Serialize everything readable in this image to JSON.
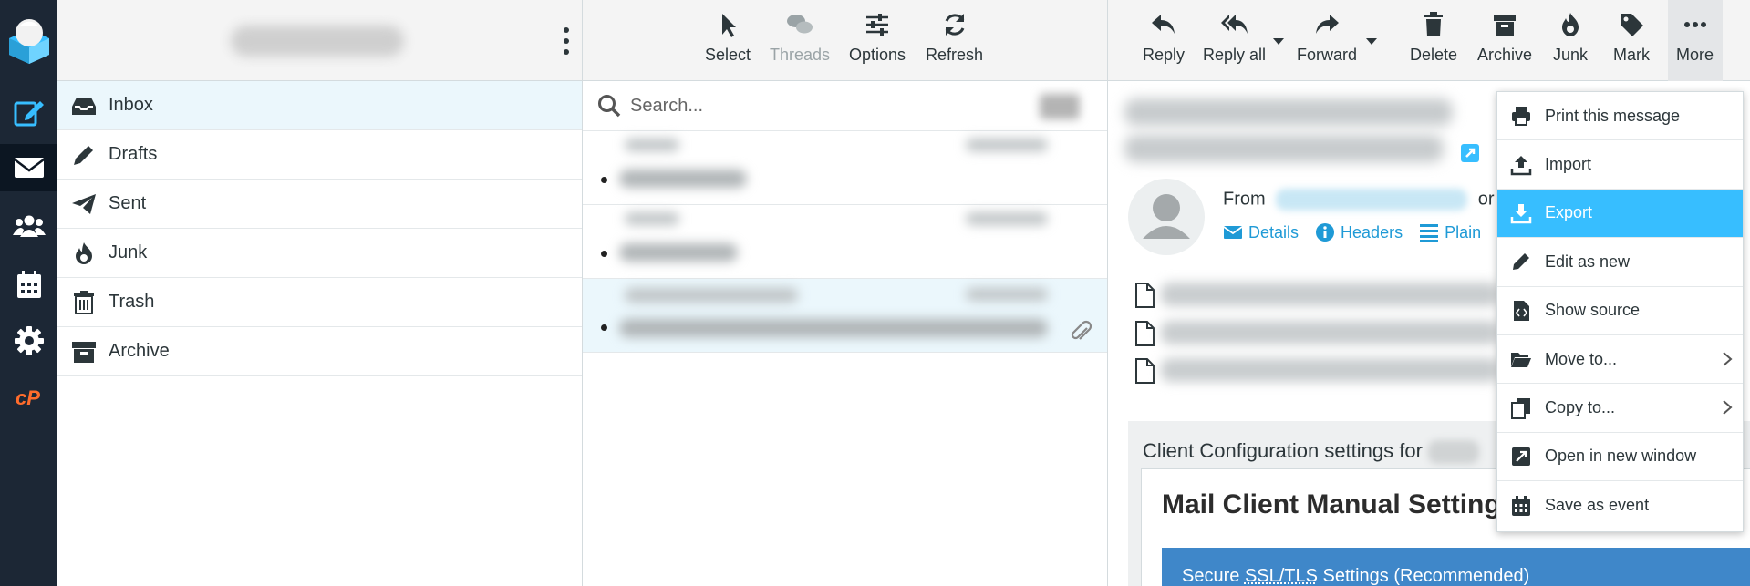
{
  "colors": {
    "accent": "#37beff",
    "link": "#1f9ad6",
    "sidebar_bg": "#1c2735",
    "cpanel_orange": "#ff6c2c"
  },
  "taskbar": {
    "items": [
      {
        "name": "compose",
        "icon": "compose-icon"
      },
      {
        "name": "mail",
        "icon": "envelope-icon"
      },
      {
        "name": "contacts",
        "icon": "users-icon"
      },
      {
        "name": "calendar",
        "icon": "calendar-icon"
      },
      {
        "name": "settings",
        "icon": "gear-icon"
      },
      {
        "name": "cpanel",
        "icon": "cpanel-icon"
      }
    ]
  },
  "folders": [
    {
      "label": "Inbox",
      "icon": "inbox-icon"
    },
    {
      "label": "Drafts",
      "icon": "pencil-icon"
    },
    {
      "label": "Sent",
      "icon": "paper-plane-icon"
    },
    {
      "label": "Junk",
      "icon": "fire-icon"
    },
    {
      "label": "Trash",
      "icon": "trash-icon"
    },
    {
      "label": "Archive",
      "icon": "archive-box-icon"
    }
  ],
  "list_toolbar": {
    "select": "Select",
    "threads": "Threads",
    "options": "Options",
    "refresh": "Refresh"
  },
  "search": {
    "placeholder": "Search..."
  },
  "message_toolbar": {
    "reply": "Reply",
    "reply_all": "Reply all",
    "forward": "Forward",
    "delete": "Delete",
    "archive": "Archive",
    "junk": "Junk",
    "mark": "Mark",
    "more": "More"
  },
  "preview": {
    "from_label": "From",
    "from_suffix": "or",
    "links": {
      "details": "Details",
      "headers": "Headers",
      "plain": "Plain"
    },
    "config_title": "Client Configuration settings for",
    "manual_heading": "Mail Client Manual Settings",
    "ssl_prefix": "Secure ",
    "ssl_abbr": "SSL/TLS",
    "ssl_suffix": " Settings (Recommended)"
  },
  "more_menu": [
    {
      "label": "Print this message",
      "icon": "printer-icon",
      "submenu": false
    },
    {
      "label": "Import",
      "icon": "upload-icon",
      "submenu": false
    },
    {
      "label": "Export",
      "icon": "download-icon",
      "submenu": false,
      "active": true
    },
    {
      "label": "Edit as new",
      "icon": "pencil-icon",
      "submenu": false
    },
    {
      "label": "Show source",
      "icon": "file-code-icon",
      "submenu": false
    },
    {
      "label": "Move to...",
      "icon": "folder-open-icon",
      "submenu": true
    },
    {
      "label": "Copy to...",
      "icon": "copy-icon",
      "submenu": true
    },
    {
      "label": "Open in new window",
      "icon": "external-window-icon",
      "submenu": false
    },
    {
      "label": "Save as event",
      "icon": "calendar-icon",
      "submenu": false
    }
  ]
}
